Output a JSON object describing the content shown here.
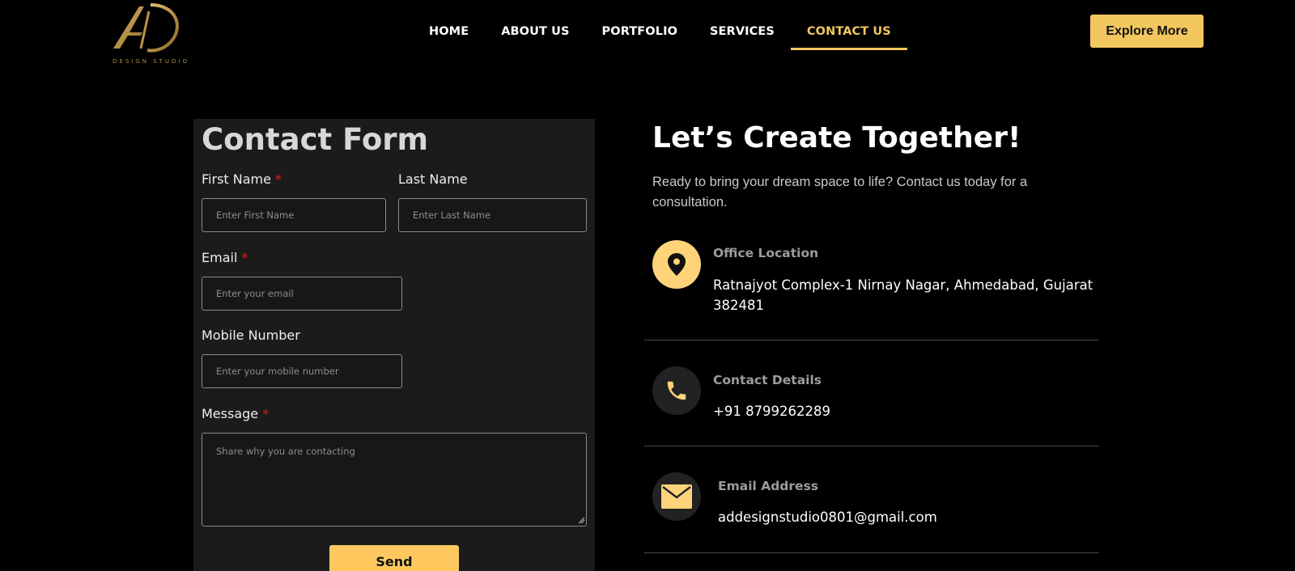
{
  "brand": {
    "logo_initials": "AD",
    "tagline": "DESIGN STUDIO"
  },
  "nav": {
    "items": [
      {
        "label": "HOME",
        "active": false
      },
      {
        "label": "ABOUT US",
        "active": false
      },
      {
        "label": "PORTFOLIO",
        "active": false
      },
      {
        "label": "SERVICES",
        "active": false
      },
      {
        "label": "CONTACT US",
        "active": true
      }
    ],
    "cta_label": "Explore More"
  },
  "form": {
    "title": "Contact Form",
    "first_name": {
      "label": "First Name",
      "required_mark": "*",
      "placeholder": "Enter First Name"
    },
    "last_name": {
      "label": "Last Name",
      "placeholder": "Enter Last Name"
    },
    "email": {
      "label": "Email",
      "required_mark": "*",
      "placeholder": "Enter your email"
    },
    "mobile": {
      "label": "Mobile Number",
      "placeholder": "Enter your mobile number"
    },
    "message": {
      "label": "Message",
      "required_mark": "*",
      "placeholder": "Share why you are contacting"
    },
    "submit_label": "Send"
  },
  "contact": {
    "title": "Let’s Create Together!",
    "description": "Ready to bring your dream space to life? Contact us today for a consultation.",
    "items": [
      {
        "title": "Office Location",
        "value": "Ratnajyot Complex-1 Nirnay Nagar, Ahmedabad, Gujarat 382481",
        "icon": "location-pin-icon"
      },
      {
        "title": "Contact Details",
        "value": "+91 8799262289",
        "icon": "phone-icon"
      },
      {
        "title": "Email Address",
        "value": "addesignstudio0801@gmail.com",
        "icon": "envelope-icon"
      }
    ]
  },
  "colors": {
    "accent": "#f1c75e",
    "background": "#000000",
    "panel": "#1b1b1b",
    "required": "#e02020"
  }
}
